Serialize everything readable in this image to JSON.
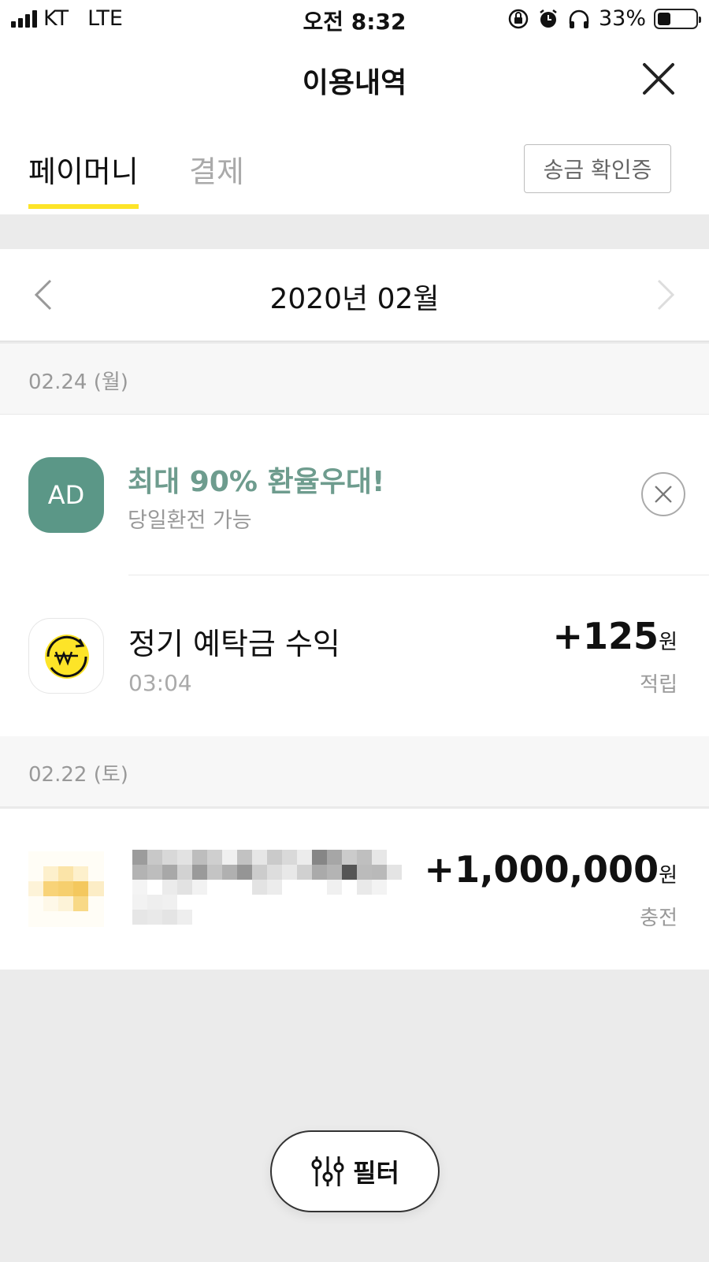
{
  "status_bar": {
    "carrier": "KT",
    "network": "LTE",
    "time": "오전 8:32",
    "battery_percent": "33%",
    "battery_level": 0.33
  },
  "header": {
    "title": "이용내역",
    "close_icon": "close-icon"
  },
  "tabs": [
    {
      "label": "페이머니",
      "active": true
    },
    {
      "label": "결제",
      "active": false
    }
  ],
  "receipt_button_label": "송금 확인증",
  "month_nav": {
    "label": "2020년 02월",
    "prev_icon": "chevron-left-icon",
    "next_icon": "chevron-right-icon"
  },
  "groups": [
    {
      "date": "02.24 (월)",
      "ad": {
        "badge": "AD",
        "title": "최대 90% 환율우대!",
        "subtitle": "당일환전 가능"
      },
      "items": [
        {
          "name": "정기 예탁금 수익",
          "time": "03:04",
          "amount": "+125",
          "unit": "원",
          "type": "적립"
        }
      ]
    },
    {
      "date": "02.22 (토)",
      "items": [
        {
          "amount": "+1,000,000",
          "unit": "원",
          "type": "충전"
        }
      ]
    }
  ],
  "filter_button_label": "필터",
  "colors": {
    "accent_yellow": "#fde428",
    "ad_green": "#5b9787"
  }
}
